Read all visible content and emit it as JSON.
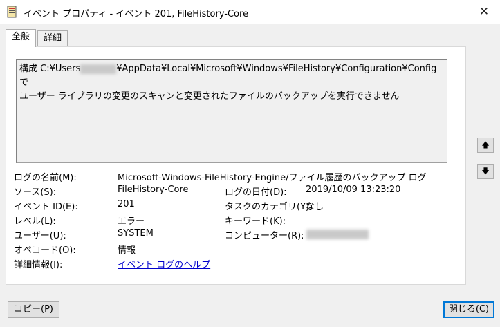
{
  "window": {
    "title": "イベント プロパティ - イベント 201, FileHistory-Core",
    "close_glyph": "✕",
    "icon": "event-viewer-icon"
  },
  "tabs": [
    {
      "label": "全般",
      "active": true
    },
    {
      "label": "詳細",
      "active": false
    }
  ],
  "description": {
    "prefix": "構成 C:¥Users",
    "suffix": "¥AppData¥Local¥Microsoft¥Windows¥FileHistory¥Configuration¥Config で",
    "line2": "ユーザー ライブラリの変更のスキャンと変更されたファイルのバックアップを実行できません"
  },
  "fields": {
    "log_name_label": "ログの名前(M):",
    "log_name_value": "Microsoft-Windows-FileHistory-Engine/ファイル履歴のバックアップ ログ",
    "source_label": "ソース(S):",
    "source_value": "FileHistory-Core",
    "logged_label": "ログの日付(D):",
    "logged_value": "2019/10/09 13:23:20",
    "event_id_label": "イベント ID(E):",
    "event_id_value": "201",
    "task_category_label": "タスクのカテゴリ(Y):",
    "task_category_value": "なし",
    "level_label": "レベル(L):",
    "level_value": "エラー",
    "keywords_label": "キーワード(K):",
    "keywords_value": "",
    "user_label": "ユーザー(U):",
    "user_value": "SYSTEM",
    "computer_label": "コンピューター(R):",
    "opcode_label": "オペコード(O):",
    "opcode_value": "情報",
    "more_info_label": "詳細情報(I):",
    "more_info_link": "イベント ログのヘルプ"
  },
  "nav": {
    "up_glyph": "🡅",
    "down_glyph": "🡇"
  },
  "buttons": {
    "copy": "コピー(P)",
    "close": "閉じる(C)"
  }
}
